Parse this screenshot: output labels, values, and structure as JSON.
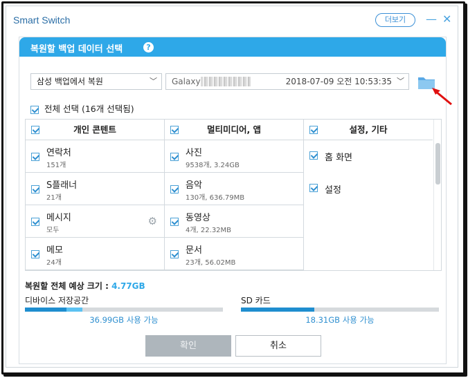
{
  "app": {
    "title": "Smart Switch",
    "more_label": "더보기",
    "minimize": "—",
    "close": "✕"
  },
  "dialog": {
    "title": "복원할 백업 데이터 선택",
    "help": "?"
  },
  "source_select": {
    "value": "삼성 백업에서 복원"
  },
  "backup_select": {
    "device_prefix": "Galaxy",
    "date": "2018-07-09 오전 10:53:35"
  },
  "select_all": {
    "label": "전체 선택 (16개 선택됨)"
  },
  "columns": [
    {
      "header": "개인 콘텐트",
      "items": [
        {
          "name": "연락처",
          "sub": "151개"
        },
        {
          "name": "S플래너",
          "sub": "21개"
        },
        {
          "name": "메시지",
          "sub": "모두"
        },
        {
          "name": "메모",
          "sub": "24개"
        }
      ]
    },
    {
      "header": "멀티미디어, 앱",
      "items": [
        {
          "name": "사진",
          "sub": "9538개, 3.24GB"
        },
        {
          "name": "음악",
          "sub": "130개, 636.79MB"
        },
        {
          "name": "동영상",
          "sub": "4개, 22.32MB"
        },
        {
          "name": "문서",
          "sub": "23개, 56.02MB"
        }
      ]
    },
    {
      "header": "설정, 기타",
      "items": [
        {
          "name": "홈 화면"
        },
        {
          "name": "설정"
        }
      ]
    }
  ],
  "estimate": {
    "label": "복원할 전체 예상 크기 : ",
    "value": "4.77GB"
  },
  "device_storage": {
    "label": "디바이스 저장공간",
    "available": "36.99GB 사용 가능",
    "used_fraction": 0.21,
    "restore_fraction": 0.08
  },
  "sd_card": {
    "label": "SD 카드",
    "available": "18.31GB 사용 가능",
    "used_fraction": 0.37
  },
  "buttons": {
    "ok": "확인",
    "cancel": "취소"
  },
  "colors": {
    "accent": "#2ea8e8",
    "header": "#2ea8e8"
  }
}
